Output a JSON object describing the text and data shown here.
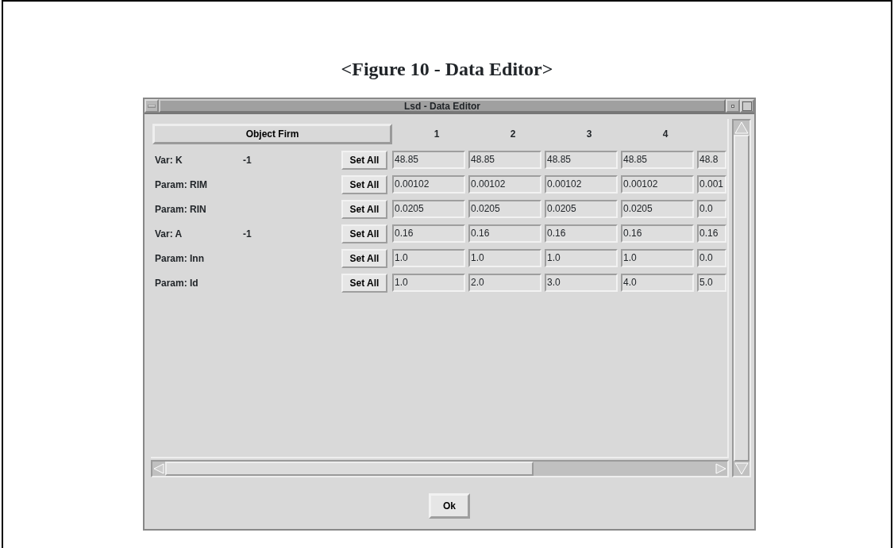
{
  "caption": "<Figure 10 - Data Editor>",
  "window": {
    "title": "Lsd - Data Editor"
  },
  "object_button": "Object Firm",
  "columns": [
    "1",
    "2",
    "3",
    "4"
  ],
  "rows": [
    {
      "label": "Var: K",
      "lag": "-1",
      "button": "Set All",
      "values": [
        "48.85",
        "48.85",
        "48.85",
        "48.85",
        "48.8"
      ]
    },
    {
      "label": "Param: RIM",
      "button": "Set All",
      "values": [
        "0.00102",
        "0.00102",
        "0.00102",
        "0.00102",
        "0.001"
      ]
    },
    {
      "label": "Param: RIN",
      "button": "Set All",
      "values": [
        "0.0205",
        "0.0205",
        "0.0205",
        "0.0205",
        "0.0"
      ]
    },
    {
      "label": "Var: A",
      "lag": "-1",
      "button": "Set All",
      "values": [
        "0.16",
        "0.16",
        "0.16",
        "0.16",
        "0.16"
      ]
    },
    {
      "label": "Param: Inn",
      "button": "Set All",
      "values": [
        "1.0",
        "1.0",
        "1.0",
        "1.0",
        "0.0"
      ]
    },
    {
      "label": "Param: Id",
      "button": "Set All",
      "values": [
        "1.0",
        "2.0",
        "3.0",
        "4.0",
        "5.0"
      ]
    }
  ],
  "ok_button": "Ok"
}
